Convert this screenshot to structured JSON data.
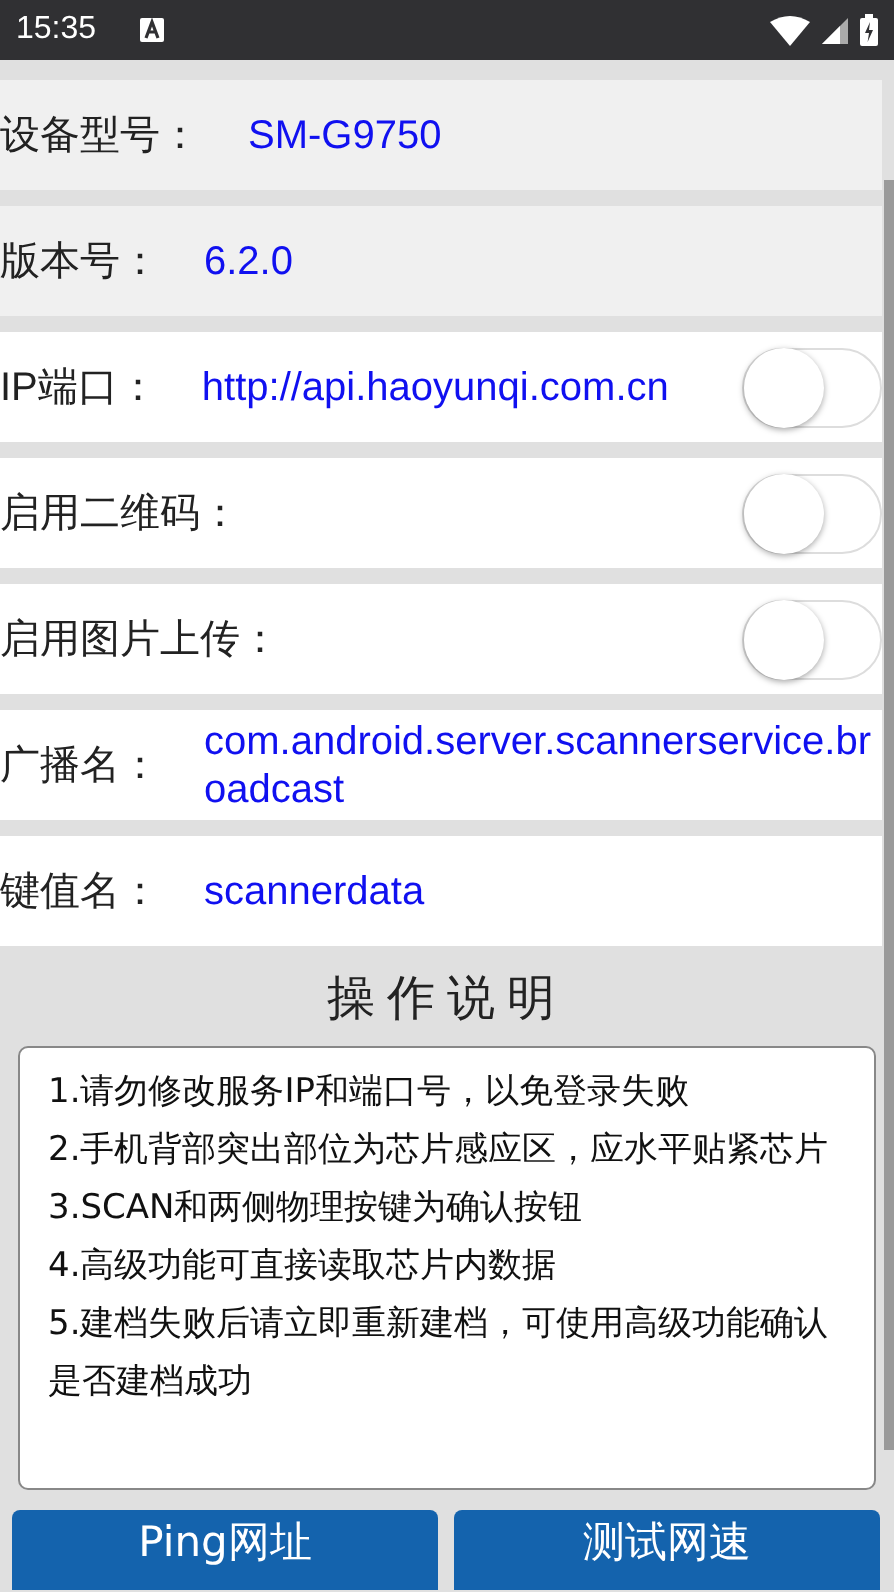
{
  "status_bar": {
    "time": "15:35"
  },
  "settings": [
    {
      "kind": "readonly",
      "label": "设备型号：",
      "value": "SM-G9750"
    },
    {
      "kind": "readonly",
      "label": "版本号：",
      "value": "6.2.0"
    },
    {
      "kind": "field",
      "label": "IP端口：",
      "value": "http://api.haoyunqi.com.cn",
      "switch_on": false
    },
    {
      "kind": "field",
      "label": "启用二维码：",
      "switch_on": false
    },
    {
      "kind": "field",
      "label": "启用图片上传：",
      "switch_on": false
    },
    {
      "kind": "field",
      "label": "广播名：",
      "value": "com.android.server.scannerservice.broadcast"
    },
    {
      "kind": "field",
      "label": "键值名：",
      "value": "scannerdata"
    }
  ],
  "instructions": {
    "title": "操作说明",
    "items": [
      "1.请勿修改服务IP和端口号，以免登录失败",
      "2.手机背部突出部位为芯片感应区，应水平贴紧芯片",
      "3.SCAN和两侧物理按键为确认按钮",
      "4.高级功能可直接读取芯片内数据",
      "5.建档失败后请立即重新建档，可使用高级功能确认是否建档成功"
    ]
  },
  "buttons": [
    "Ping网址",
    "测试网速"
  ]
}
